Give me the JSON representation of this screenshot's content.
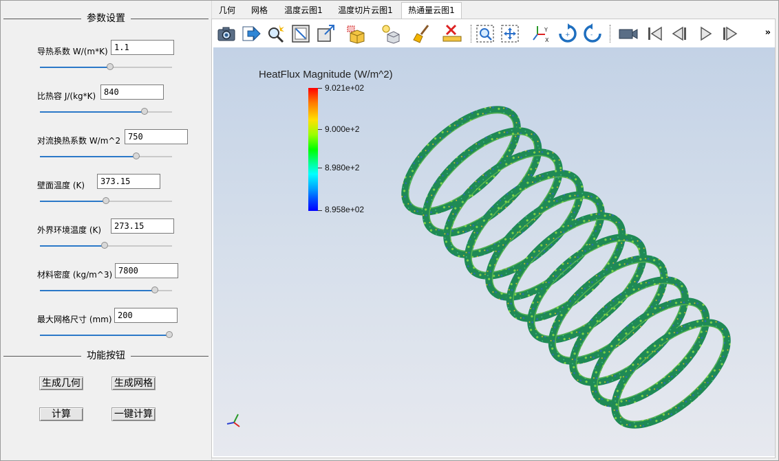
{
  "params_group": {
    "title": "参数设置",
    "items": [
      {
        "label": "导热系数 W/(m*K)",
        "value": "1.1",
        "slider": 0.53
      },
      {
        "label": "比热容 J/(kg*K)",
        "value": "840",
        "slider": 0.79
      },
      {
        "label": "对流换热系数 W/m^2",
        "value": "750",
        "slider": 0.73
      },
      {
        "label": "壁面温度 (K)",
        "value": "373.15",
        "slider": 0.5
      },
      {
        "label": "外界环境温度 (K)",
        "value": "273.15",
        "slider": 0.49
      },
      {
        "label": "材料密度 (kg/m^3)",
        "value": "7800",
        "slider": 0.87
      },
      {
        "label": "最大网格尺寸 (mm)",
        "value": "200",
        "slider": 0.98
      }
    ]
  },
  "buttons_group": {
    "title": "功能按钮",
    "gen_geometry": "生成几何",
    "gen_mesh": "生成网格",
    "compute": "计算",
    "one_click": "一键计算"
  },
  "tabs": [
    "几何",
    "网格",
    "温度云图1",
    "温度切片云图1",
    "热通量云图1"
  ],
  "active_tab": 4,
  "toolbar_icons": [
    "camera-icon",
    "export-icon",
    "zoom-magic-icon",
    "fit-frame-icon",
    "restore-frame-icon",
    "box-select-icon",
    "light-icon",
    "cube-icon",
    "clear-brush-icon",
    "ruler-clear-icon",
    "zoom-box-icon",
    "pan-icon",
    "axes-orient-icon",
    "rotate-cw-icon",
    "rotate-ccw-icon",
    "video-camera-icon",
    "first-frame-icon",
    "previous-frame-icon",
    "play-icon",
    "last-frame-icon",
    "more-icon"
  ],
  "legend": {
    "title": "HeatFlux Magnitude (W/m^2)",
    "labels": [
      "9.021e+02",
      "9.000e+2",
      "8.980e+2",
      "8.958e+02"
    ]
  },
  "colors": {
    "accent": "#2a78c8",
    "spring_base": "#1f8a55",
    "spring_highlight": "#7fd34a"
  }
}
